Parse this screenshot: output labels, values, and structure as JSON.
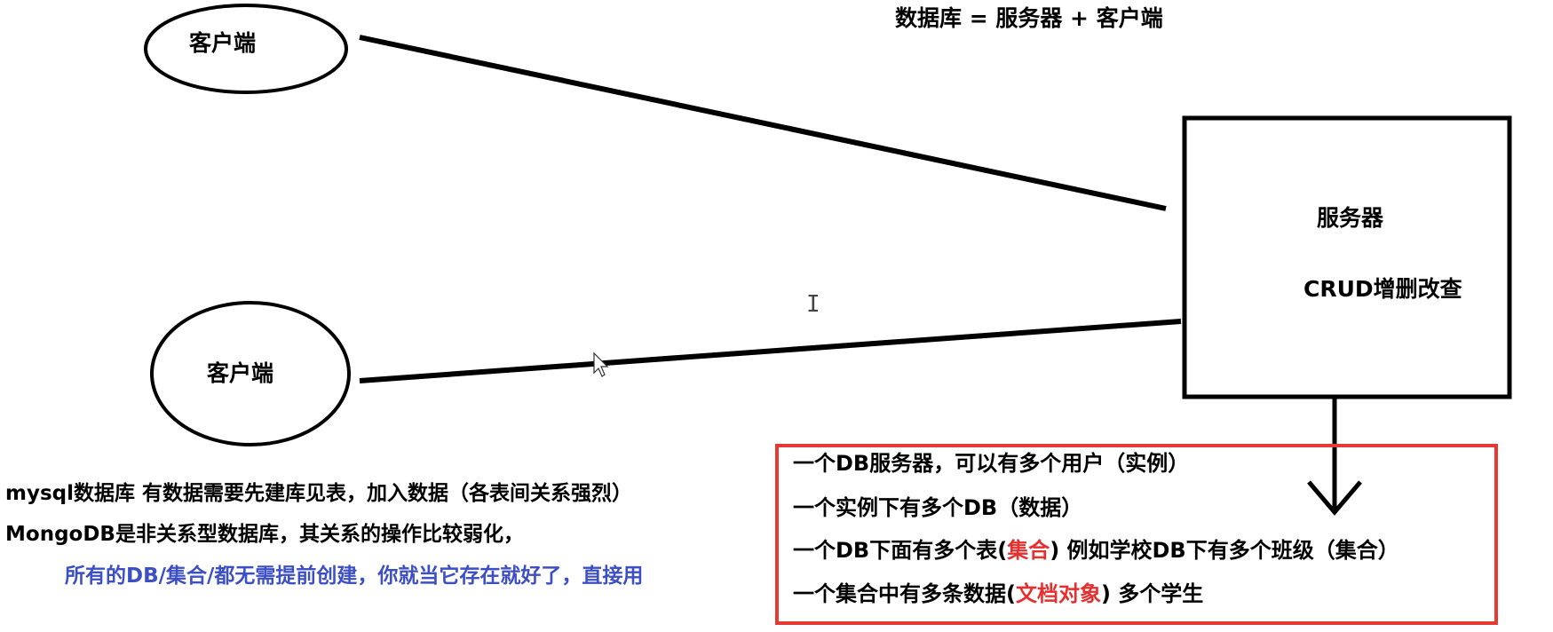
{
  "title": "数据库 = 服务器 + 客户端",
  "client_top": {
    "label": "客户端"
  },
  "client_bottom": {
    "label": "客户端"
  },
  "server": {
    "label": "服务器",
    "crud": "CRUD增删改查"
  },
  "left_notes": {
    "line1": "mysql数据库  有数据需要先建库见表，加入数据（各表间关系强烈）",
    "line2": "MongoDB是非关系型数据库，其关系的操作比较弱化，",
    "line3": "所有的DB/集合/都无需提前创建，你就当它存在就好了，直接用"
  },
  "box_notes": {
    "line1": "一个DB服务器，可以有多个用户（实例）",
    "line2": "一个实例下有多个DB（数据）",
    "line3_a": "一个DB下面有多个表(",
    "line3_b": "集合",
    "line3_c": ")    例如学校DB下有多个班级（集合）",
    "line4_a": "一个集合中有多条数据(",
    "line4_b": "文档对象",
    "line4_c": ")  多个学生"
  },
  "colors": {
    "highlight_red": "#e53030",
    "note_blue": "#3c4fc4",
    "box_border": "#e53935"
  }
}
